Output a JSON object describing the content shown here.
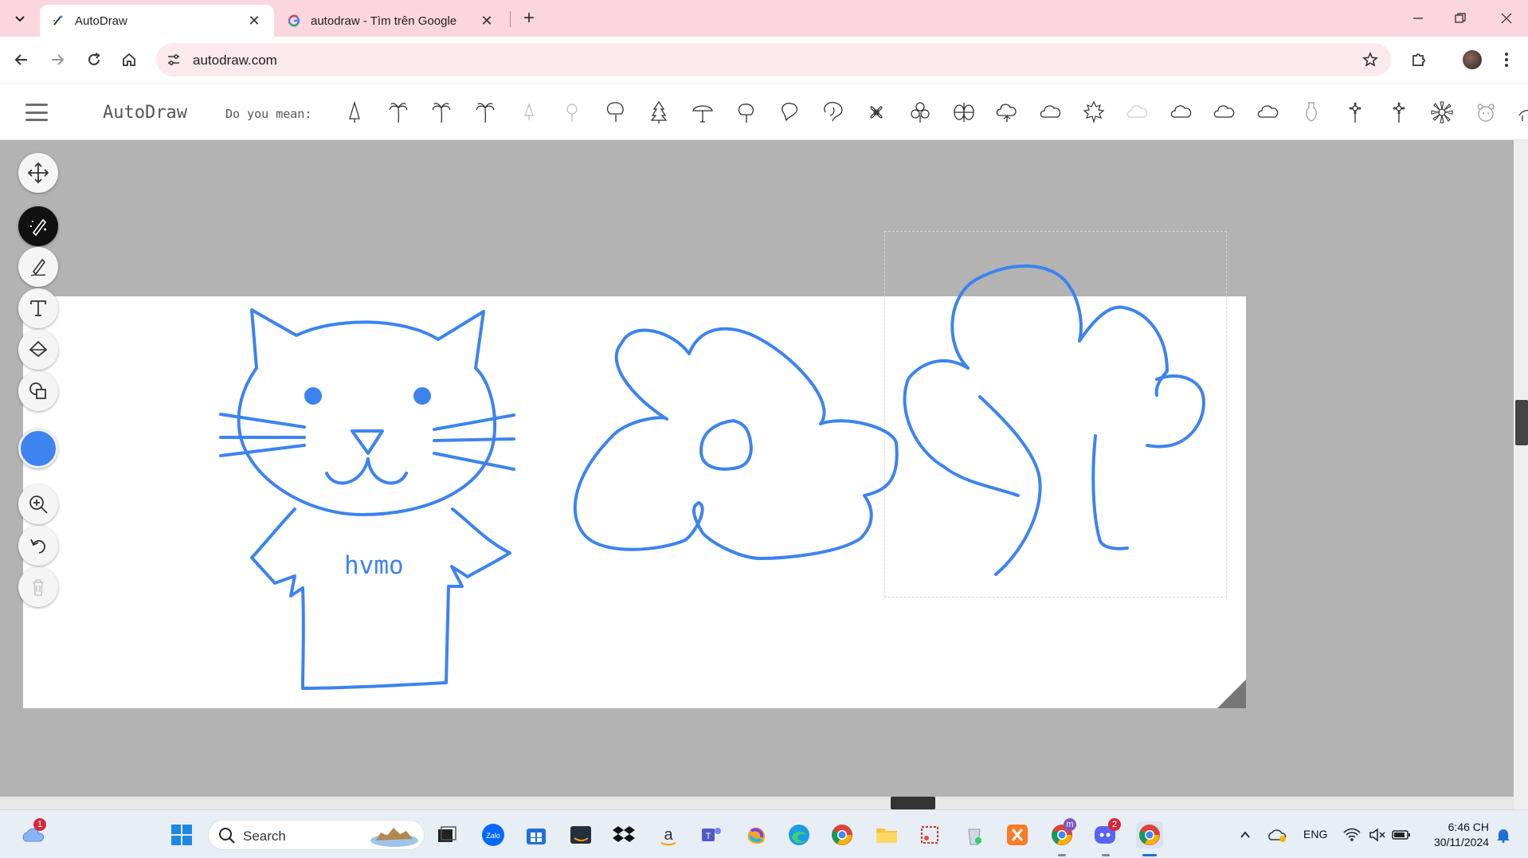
{
  "browser": {
    "tabs": [
      {
        "title": "AutoDraw",
        "active": true
      },
      {
        "title": "autodraw - Tìm trên Google",
        "active": false
      }
    ],
    "url": "autodraw.com"
  },
  "app": {
    "brand": "AutoDraw",
    "suggestions_label": "Do you mean:",
    "suggestion_icons": [
      "pine-sapling-icon",
      "palm-tree-icon",
      "palm-tree-icon",
      "palm-tree-icon",
      "small-tree-icon",
      "lightbulb-icon",
      "round-tree-icon",
      "pine-tree-icon",
      "mushroom-tree-icon",
      "tree-icon",
      "leaf-tree-icon",
      "bushy-tree-icon",
      "flower-petals-icon",
      "clover-icon",
      "four-leaf-icon",
      "cloud-tree-icon",
      "cloud-icon",
      "maple-leaf-icon",
      "faint-cloud-icon",
      "cloud-icon",
      "cloud-icon",
      "cloud-icon",
      "vase-icon",
      "flower-icon",
      "flower-icon",
      "daisy-icon",
      "bear-face-icon",
      "animal-icon"
    ],
    "canvas_text": "hvmo",
    "stroke_color": "#3d83f0",
    "tools": [
      "move",
      "autodraw",
      "draw",
      "type",
      "fill",
      "shape",
      "color",
      "zoom",
      "undo",
      "delete"
    ]
  },
  "taskbar": {
    "search_placeholder": "Search",
    "weather_badge": "1",
    "messenger_badge": "m",
    "discord_badge": "2",
    "language": "ENG",
    "time": "6:46 CH",
    "date": "30/11/2024"
  }
}
